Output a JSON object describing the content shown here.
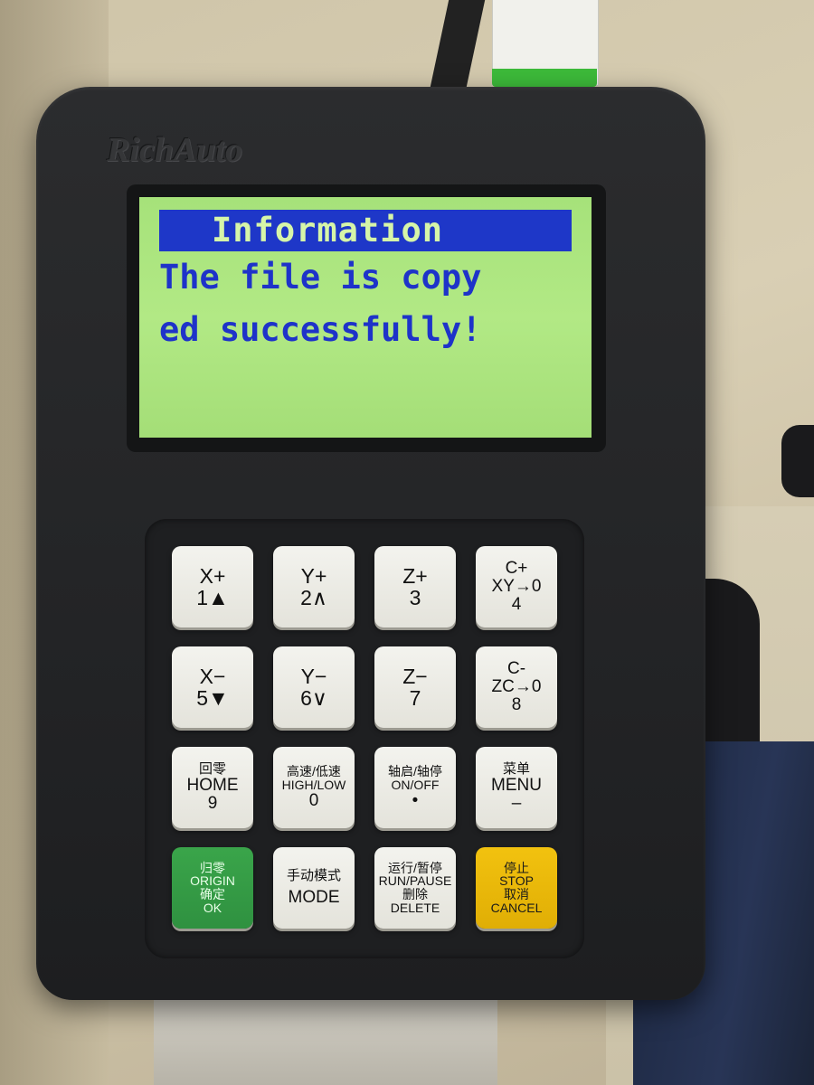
{
  "device": {
    "brand": "RichAuto"
  },
  "screen": {
    "title": "Information",
    "lines": [
      "The file is copy",
      "ed successfully!"
    ]
  },
  "keys": [
    {
      "name": "key-x-plus-1",
      "lines": [
        "X+",
        "1▲"
      ]
    },
    {
      "name": "key-y-plus-2",
      "lines": [
        "Y+",
        "2∧"
      ]
    },
    {
      "name": "key-z-plus-3",
      "lines": [
        "Z+",
        "3"
      ]
    },
    {
      "name": "key-c-plus-4",
      "lines": [
        "C+",
        "XY→0",
        "4"
      ]
    },
    {
      "name": "key-x-minus-5",
      "lines": [
        "X−",
        "5▼"
      ]
    },
    {
      "name": "key-y-minus-6",
      "lines": [
        "Y−",
        "6∨"
      ]
    },
    {
      "name": "key-z-minus-7",
      "lines": [
        "Z−",
        "7"
      ]
    },
    {
      "name": "key-c-minus-8",
      "lines": [
        "C-",
        "ZC→0",
        "8"
      ]
    },
    {
      "name": "key-home-9",
      "lines": [
        "回零",
        "HOME",
        "9"
      ]
    },
    {
      "name": "key-high-low-0",
      "lines": [
        "高速/低速",
        "HIGH/LOW",
        "0"
      ]
    },
    {
      "name": "key-on-off-dot",
      "lines": [
        "轴启/轴停",
        "ON/OFF",
        "•"
      ]
    },
    {
      "name": "key-menu-minus",
      "lines": [
        "菜单",
        "MENU",
        "–"
      ]
    },
    {
      "name": "key-origin-ok",
      "lines": [
        "归零",
        "ORIGIN",
        "确定",
        "OK"
      ]
    },
    {
      "name": "key-mode",
      "lines": [
        "手动模式",
        "MODE"
      ]
    },
    {
      "name": "key-run-pause-delete",
      "lines": [
        "运行/暂停",
        "RUN/PAUSE",
        "删除",
        "DELETE"
      ]
    },
    {
      "name": "key-stop-cancel",
      "lines": [
        "停止",
        "STOP",
        "取消",
        "CANCEL"
      ]
    }
  ],
  "colors": {
    "lcd_background": "#a6e27a",
    "lcd_text": "#1e33c9",
    "origin_key": "#3aa54a",
    "stop_key": "#f2c20f"
  }
}
